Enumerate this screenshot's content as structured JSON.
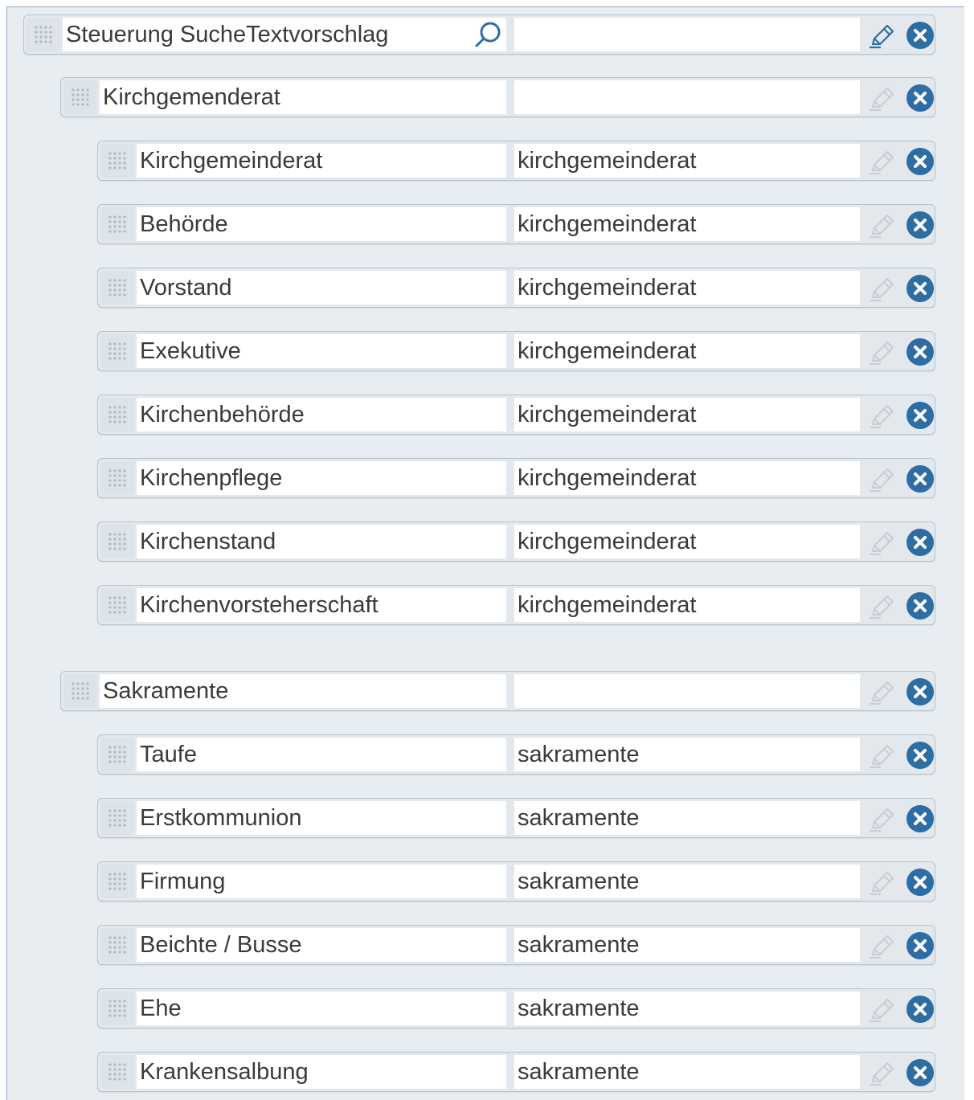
{
  "root": {
    "label": "Steuerung SucheTextvorschlag",
    "value": "",
    "icons": {
      "search": "search-icon",
      "edit": "pencil-icon",
      "remove": "close-circle-icon"
    }
  },
  "groups": [
    {
      "label": "Kirchgemenderat",
      "value": "",
      "items": [
        {
          "label": "Kirchgemeinderat",
          "value": "kirchgemeinderat"
        },
        {
          "label": "Behörde",
          "value": "kirchgemeinderat"
        },
        {
          "label": "Vorstand",
          "value": "kirchgemeinderat"
        },
        {
          "label": "Exekutive",
          "value": "kirchgemeinderat"
        },
        {
          "label": "Kirchenbehörde",
          "value": "kirchgemeinderat"
        },
        {
          "label": "Kirchenpflege",
          "value": "kirchgemeinderat"
        },
        {
          "label": "Kirchenstand",
          "value": "kirchgemeinderat"
        },
        {
          "label": "Kirchenvorsteherschaft",
          "value": "kirchgemeinderat"
        }
      ]
    },
    {
      "label": "Sakramente",
      "value": "",
      "items": [
        {
          "label": "Taufe",
          "value": "sakramente"
        },
        {
          "label": "Erstkommunion",
          "value": "sakramente"
        },
        {
          "label": "Firmung",
          "value": "sakramente"
        },
        {
          "label": "Beichte / Busse",
          "value": "sakramente"
        },
        {
          "label": "Ehe",
          "value": "sakramente"
        },
        {
          "label": "Krankensalbung",
          "value": "sakramente"
        }
      ]
    }
  ],
  "colors": {
    "panel_bg": "#e8edf2",
    "row_bg": "#e3e8ed",
    "remove_icon": "#2e6da4",
    "edit_icon_active": "#2e6da4",
    "edit_icon_disabled": "#c8ced4",
    "search_icon": "#2e6da4"
  }
}
